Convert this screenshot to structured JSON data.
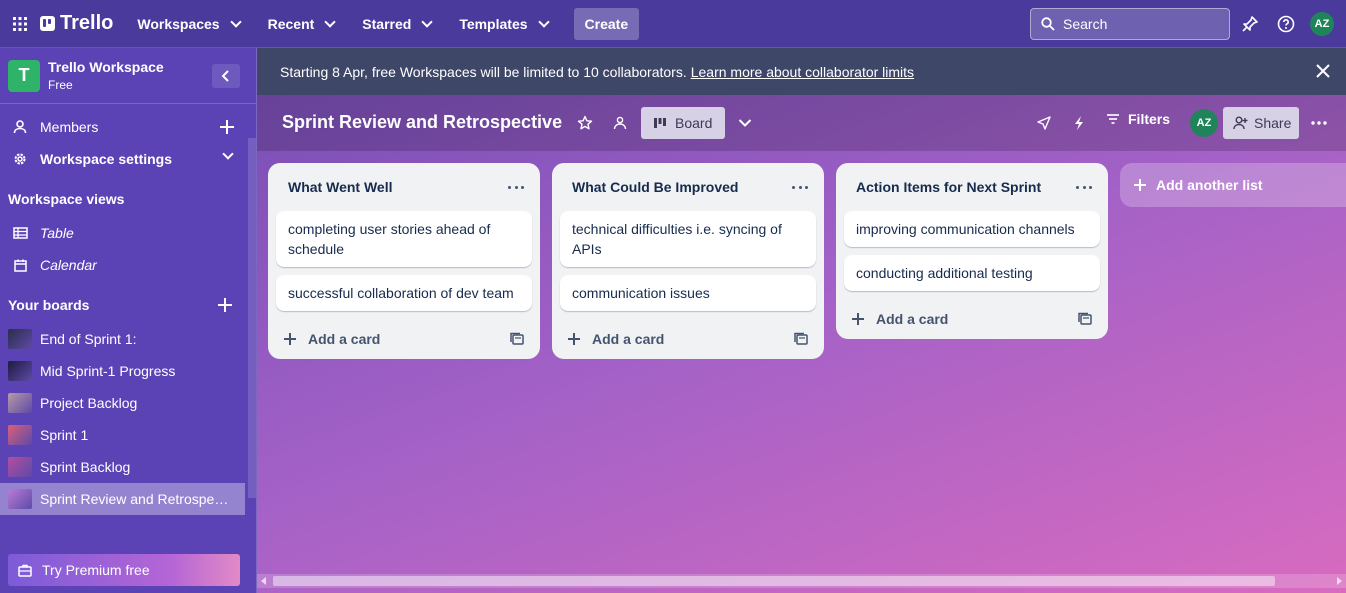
{
  "topnav": {
    "logo_text": "Trello",
    "menus": [
      "Workspaces",
      "Recent",
      "Starred",
      "Templates"
    ],
    "create_label": "Create",
    "search_placeholder": "Search",
    "avatar_initials": "AZ"
  },
  "sidebar": {
    "workspace_name": "Trello Workspace",
    "workspace_initial": "T",
    "workspace_plan": "Free",
    "members_label": "Members",
    "settings_label": "Workspace settings",
    "views_heading": "Workspace views",
    "views": [
      "Table",
      "Calendar"
    ],
    "boards_heading": "Your boards",
    "boards": [
      {
        "name": "End of Sprint 1:",
        "thumb": "#2c2d4a"
      },
      {
        "name": "Mid Sprint-1 Progress",
        "thumb": "#1e1b3e"
      },
      {
        "name": "Project Backlog",
        "thumb": "#b79aa6"
      },
      {
        "name": "Sprint 1",
        "thumb": "#d8607a"
      },
      {
        "name": "Sprint Backlog",
        "thumb": "#b34ea0"
      },
      {
        "name": "Sprint Review and Retrospective",
        "thumb": "#b97cd6",
        "active": true
      }
    ],
    "premium_label": "Try Premium free"
  },
  "banner": {
    "text": "Starting 8 Apr, free Workspaces will be limited to 10 collaborators.",
    "link": "Learn more about collaborator limits"
  },
  "board": {
    "title": "Sprint Review and Retrospective",
    "view_label": "Board",
    "filters_label": "Filters",
    "share_label": "Share",
    "avatar_initials": "AZ",
    "add_list_label": "Add another list",
    "add_card_label": "Add a card",
    "lists": [
      {
        "title": "What Went Well",
        "cards": [
          "completing user stories ahead of schedule",
          "successful collaboration of dev team"
        ]
      },
      {
        "title": "What Could Be Improved",
        "cards": [
          "technical difficulties i.e. syncing of APIs",
          "communication issues"
        ]
      },
      {
        "title": "Action Items for Next Sprint",
        "cards": [
          "improving communication channels",
          "conducting additional testing"
        ]
      }
    ]
  },
  "colors": {
    "nav_bg": "#4a3a9c",
    "sidebar_bg": "#5b43b5",
    "banner_bg": "#3e4768",
    "list_bg": "#f1f2f4",
    "avatar_bg": "#1f845a"
  }
}
